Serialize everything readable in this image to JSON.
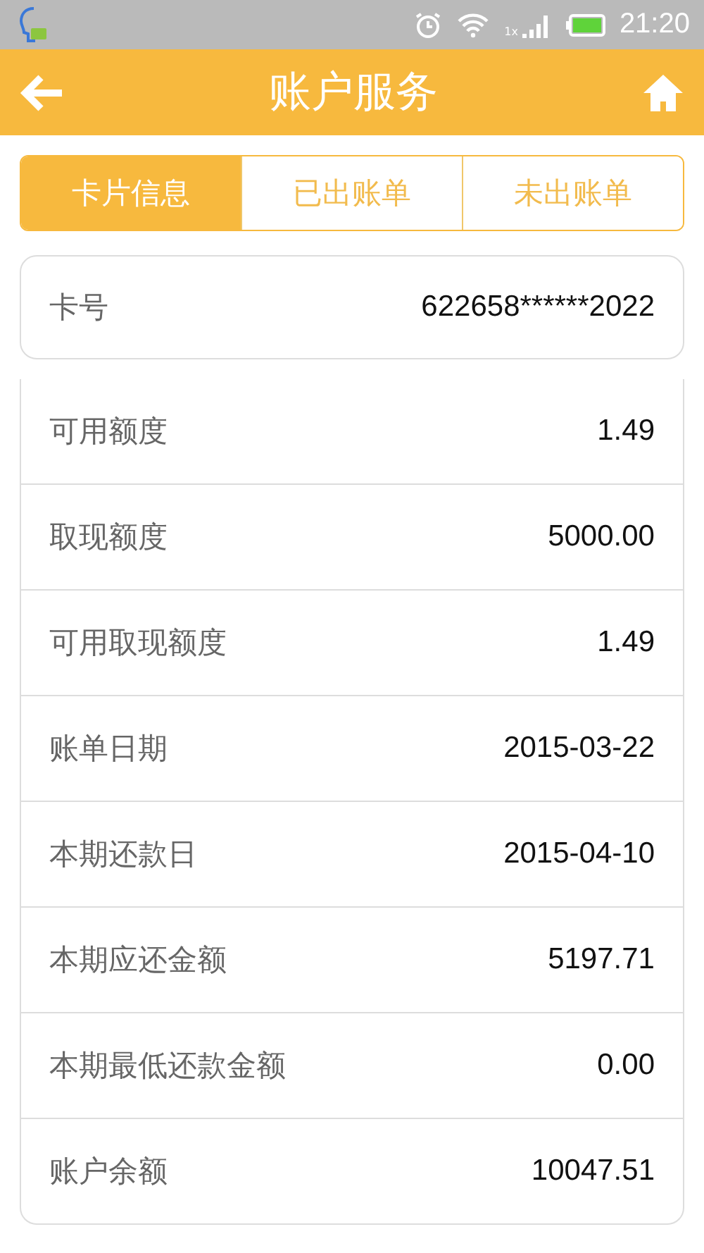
{
  "status_bar": {
    "network_label": "1x",
    "time": "21:20"
  },
  "header": {
    "title": "账户服务"
  },
  "tabs": [
    {
      "label": "卡片信息",
      "selected": true
    },
    {
      "label": "已出账单",
      "selected": false
    },
    {
      "label": "未出账单",
      "selected": false
    }
  ],
  "card_number": {
    "label": "卡号",
    "value": "622658******2022"
  },
  "details": [
    {
      "label": "可用额度",
      "value": "1.49"
    },
    {
      "label": "取现额度",
      "value": "5000.00"
    },
    {
      "label": "可用取现额度",
      "value": "1.49"
    },
    {
      "label": "账单日期",
      "value": "2015-03-22"
    },
    {
      "label": "本期还款日",
      "value": "2015-04-10"
    },
    {
      "label": "本期应还金额",
      "value": "5197.71"
    },
    {
      "label": "本期最低还款金额",
      "value": "0.00"
    },
    {
      "label": "账户余额",
      "value": "10047.51"
    }
  ]
}
